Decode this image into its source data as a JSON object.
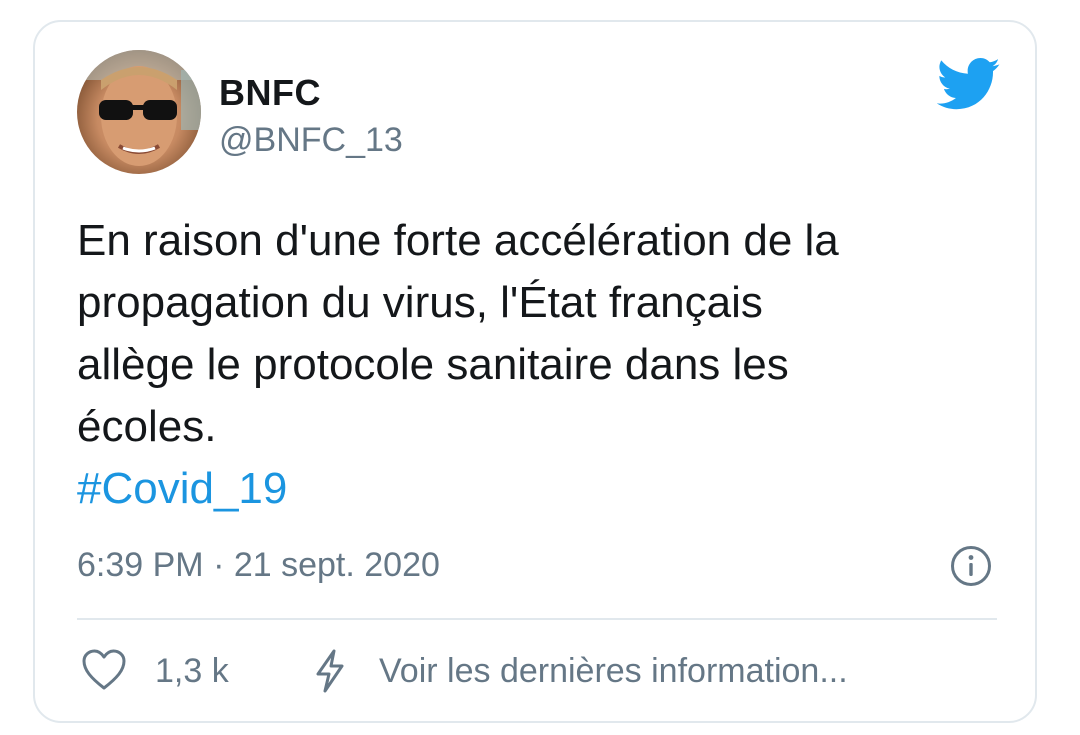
{
  "user": {
    "name": "BNFC",
    "handle": "@BNFC_13"
  },
  "tweet": {
    "lines": [
      "En raison d'une forte accélération de la",
      "propagation du virus, l'État français",
      "allège le protocole sanitaire dans les",
      "écoles."
    ],
    "hashtag": "#Covid_19",
    "timestamp": "6:39 PM · 21 sept. 2020"
  },
  "actions": {
    "likes": "1,3 k",
    "latest_info": "Voir les dernières information..."
  },
  "icons": {
    "brand": "twitter-bird-icon",
    "info": "info-icon",
    "like": "heart-icon",
    "moments": "lightning-icon"
  },
  "colors": {
    "brand": "#1da1f2",
    "link": "#1b95e0",
    "muted": "#657786",
    "text": "#14171a",
    "border": "#e1e8ed"
  }
}
